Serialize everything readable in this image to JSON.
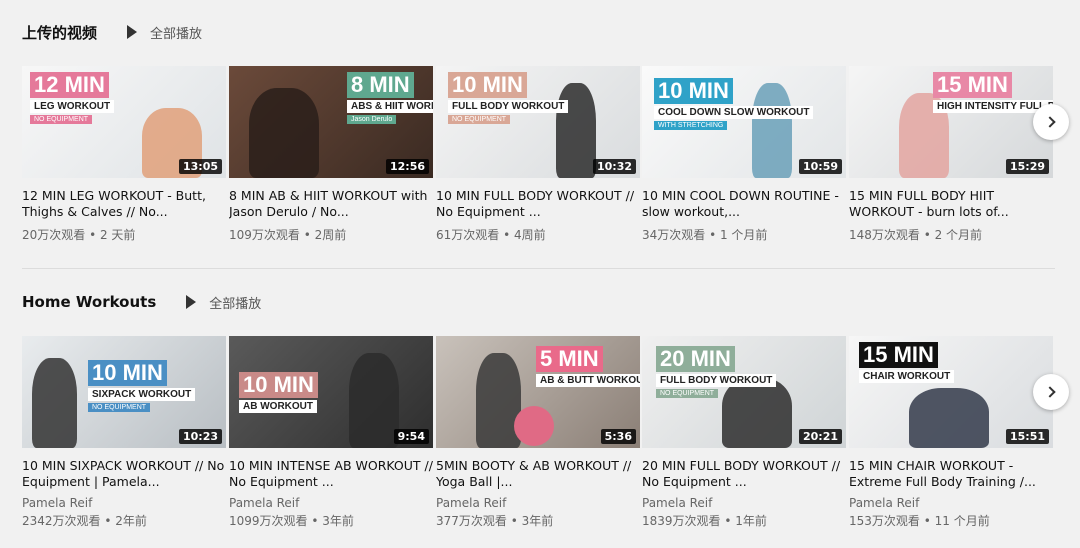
{
  "shelves": [
    {
      "title": "上传的视频",
      "play_all": "全部播放",
      "videos": [
        {
          "title": "12 MIN LEG WORKOUT - Butt, Thighs & Calves // No...",
          "views": "20万次观看 • 2 天前",
          "duration": "13:05",
          "thumb": {
            "big": "12 MIN",
            "sub": "LEG WORKOUT",
            "tag": "NO EQUIPMENT",
            "accent": "#e5799a"
          }
        },
        {
          "title": "8 MIN AB & HIIT WORKOUT with Jason Derulo / No...",
          "views": "109万次观看 • 2周前",
          "duration": "12:56",
          "thumb": {
            "big": "8 MIN",
            "sub": "ABS & HIIT WORKOUT",
            "tag": "Jason Derulo",
            "accent": "#5fa88f"
          }
        },
        {
          "title": "10 MIN FULL BODY WORKOUT // No Equipment ...",
          "views": "61万次观看 • 4周前",
          "duration": "10:32",
          "thumb": {
            "big": "10 MIN",
            "sub": "FULL BODY WORKOUT",
            "tag": "NO EQUIPMENT",
            "accent": "#d9a796"
          }
        },
        {
          "title": "10 MIN COOL DOWN ROUTINE - slow workout,...",
          "views": "34万次观看 • 1 个月前",
          "duration": "10:59",
          "thumb": {
            "big": "10 MIN",
            "sub": "COOL DOWN SLOW WORKOUT",
            "tag": "WITH STRETCHING",
            "accent": "#2fa2c8"
          }
        },
        {
          "title": "15 MIN FULL BODY HIIT WORKOUT - burn lots of...",
          "views": "148万次观看 • 2 个月前",
          "duration": "15:29",
          "thumb": {
            "big": "15 MIN",
            "sub": "HIGH INTENSITY FULL BODY",
            "tag": "",
            "accent": "#e888a6"
          }
        }
      ]
    },
    {
      "title": "Home Workouts",
      "play_all": "全部播放",
      "videos": [
        {
          "title": "10 MIN SIXPACK WORKOUT // No Equipment | Pamela...",
          "channel": "Pamela Reif",
          "views": "2342万次观看 • 2年前",
          "duration": "10:23",
          "thumb": {
            "big": "10 MIN",
            "sub": "SIXPACK WORKOUT",
            "tag": "NO EQUIPMENT",
            "accent": "#4a8fc4"
          }
        },
        {
          "title": "10 MIN INTENSE AB WORKOUT // No Equipment ...",
          "channel": "Pamela Reif",
          "views": "1099万次观看 • 3年前",
          "duration": "9:54",
          "thumb": {
            "big": "10 MIN",
            "sub": "AB WORKOUT",
            "tag": "",
            "accent": "#c98a88"
          }
        },
        {
          "title": "5MIN BOOTY & AB WORKOUT // Yoga Ball |...",
          "channel": "Pamela Reif",
          "views": "377万次观看 • 3年前",
          "duration": "5:36",
          "thumb": {
            "big": "5 MIN",
            "sub": "AB & BUTT WORKOUT",
            "tag": "",
            "accent": "#e96a8a"
          }
        },
        {
          "title": "20 MIN FULL BODY WORKOUT // No Equipment ...",
          "channel": "Pamela Reif",
          "views": "1839万次观看 • 1年前",
          "duration": "20:21",
          "thumb": {
            "big": "20 MIN",
            "sub": "FULL BODY WORKOUT",
            "tag": "NO EQUIPMENT",
            "accent": "#8fae9a"
          }
        },
        {
          "title": "15 MIN CHAIR WORKOUT - Extreme Full Body Training /...",
          "channel": "Pamela Reif",
          "views": "153万次观看 • 11 个月前",
          "duration": "15:51",
          "thumb": {
            "big": "15 MIN",
            "sub": "CHAIR WORKOUT",
            "tag": "",
            "accent": "#111111"
          }
        }
      ]
    }
  ],
  "icons": {
    "play_all": "play-icon",
    "next": "chevron-right-icon"
  }
}
